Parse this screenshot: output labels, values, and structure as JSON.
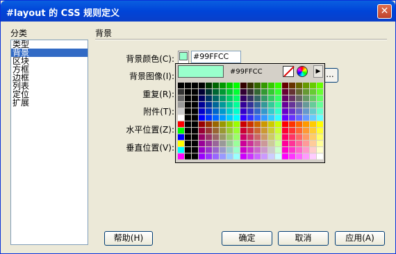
{
  "window": {
    "title": "#layout 的 CSS 规则定义",
    "close_label": "✕"
  },
  "category": {
    "label": "分类",
    "items": [
      "类型",
      "背景",
      "区块",
      "方框",
      "边框",
      "列表",
      "定位",
      "扩展"
    ],
    "selected_index": 1
  },
  "section": {
    "title": "背景"
  },
  "fields": {
    "bg_color_label": "背景颜色(C):",
    "bg_color_value": "#99FFCC",
    "bg_image_label": "背景图像(I):",
    "repeat_label": "重复(R):",
    "attachment_label": "附件(T):",
    "hpos_label": "水平位置(Z):",
    "vpos_label": "垂直位置(V):",
    "browse_label": "..."
  },
  "picker": {
    "hex": "#99FFCC",
    "menu_arrow": "▶"
  },
  "buttons": {
    "help": "帮助(H)",
    "ok": "确定",
    "cancel": "取消",
    "apply": "应用(A)"
  },
  "colors": {
    "selected": "#99ffcc"
  }
}
